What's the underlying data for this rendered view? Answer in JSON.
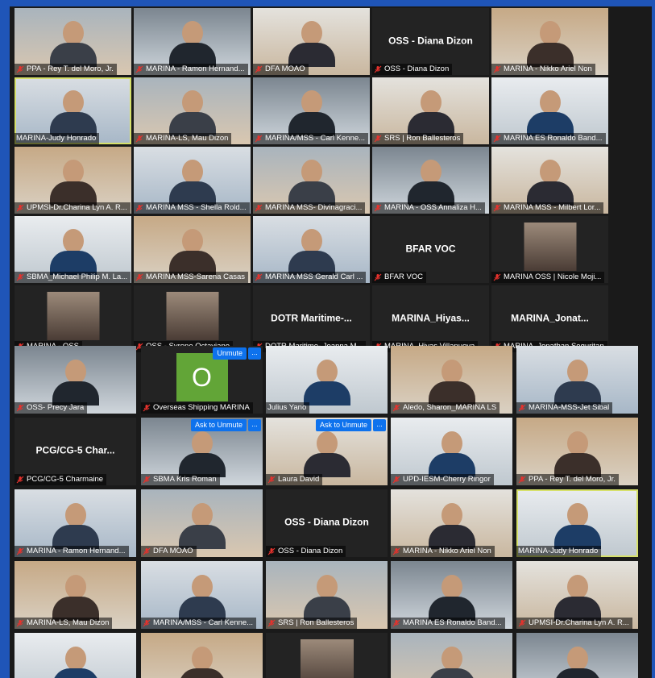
{
  "meeting": {
    "colors": {
      "background": "#1f55b8",
      "active_speaker": "#d6e06a",
      "button_blue": "#0e72ed"
    },
    "icons": {
      "muted": "muted-mic-icon",
      "more": "more-options-icon"
    },
    "buttons": {
      "unmute": "Unmute",
      "ask_to_unmute": "Ask to Unmute",
      "more": "..."
    },
    "tiles": [
      {
        "name": "PPA - Rey T. del Moro, Jr.",
        "type": "video",
        "muted": true
      },
      {
        "name": "MARINA - Ramon Hernand...",
        "type": "video",
        "muted": true
      },
      {
        "name": "DFA MOAO",
        "type": "video",
        "muted": true
      },
      {
        "name": "OSS - Diana Dizon",
        "type": "name",
        "display": "OSS - Diana Dizon",
        "muted": true
      },
      {
        "name": "MARINA - Nikko Ariel Non",
        "type": "video",
        "muted": true
      },
      {
        "name": "MARINA-Judy Honrado",
        "type": "video",
        "muted": false,
        "active": true
      },
      {
        "name": "MARINA-LS, Mau Dizon",
        "type": "video",
        "muted": true
      },
      {
        "name": "MARINA/MSS - Carl Kenne...",
        "type": "video",
        "muted": true
      },
      {
        "name": "SRS | Ron Ballesteros",
        "type": "video",
        "muted": true
      },
      {
        "name": "MARINA ES Ronaldo Band...",
        "type": "video",
        "muted": true
      },
      {
        "name": "UPMSI-Dr.Charina Lyn A. R...",
        "type": "video",
        "muted": true
      },
      {
        "name": "MARINA MSS - Shella Rold...",
        "type": "video",
        "muted": true
      },
      {
        "name": "MARINA MSS- Divinagraci...",
        "type": "video",
        "muted": true
      },
      {
        "name": "MARINA - OSS Annaliza H...",
        "type": "video",
        "muted": true
      },
      {
        "name": "MARINA MSS - Milbert Lor...",
        "type": "video",
        "muted": true
      },
      {
        "name": "SBMA_Michael Philip M. La...",
        "type": "video",
        "muted": true
      },
      {
        "name": "MARINA MSS-Sarena Casas",
        "type": "video",
        "muted": true
      },
      {
        "name": "MARINA MSS Gerald Carl ...",
        "type": "video",
        "muted": true
      },
      {
        "name": "BFAR VOC",
        "type": "name",
        "display": "BFAR VOC",
        "muted": true
      },
      {
        "name": "MARINA OSS | Nicole Moji...",
        "type": "photo",
        "muted": true
      },
      {
        "name": "MARINA - OSS",
        "type": "photo",
        "muted": true
      },
      {
        "name": "OSS - Syrene Octaviano",
        "type": "photo",
        "muted": true
      },
      {
        "name": "DOTR Maritime- Joanna M...",
        "type": "name",
        "display": "DOTR Maritime-...",
        "muted": true
      },
      {
        "name": "MARINA_Hiyas Villanueva",
        "type": "name",
        "display": "MARINA_Hiyas...",
        "muted": true
      },
      {
        "name": "MARINA_Jonathan Seguritan",
        "type": "name",
        "display": "MARINA_Jonat...",
        "muted": true
      },
      {
        "name": "OSS- Precy Jara",
        "type": "video",
        "muted": true
      },
      {
        "name": "Overseas Shipping MARINA",
        "type": "avatar",
        "letter": "O",
        "muted": true,
        "button": "unmute"
      },
      {
        "name": "Julius Yano",
        "type": "video",
        "muted": false
      },
      {
        "name": "Aledo, Sharon_MARINA LS",
        "type": "video",
        "muted": true
      },
      {
        "name": "MARINA-MSS-Jet Sibal",
        "type": "video",
        "muted": true
      },
      {
        "name": "PCG/CG-5 Charmaine",
        "type": "name",
        "display": "PCG/CG-5 Char...",
        "muted": true
      },
      {
        "name": "SBMA Kris Roman",
        "type": "video",
        "muted": true,
        "button": "ask"
      },
      {
        "name": "Laura David",
        "type": "video",
        "muted": true,
        "button": "ask"
      },
      {
        "name": "UPD-IESM-Cherry Ringor",
        "type": "video",
        "muted": true
      },
      {
        "name": "PPA - Rey T. del Moro, Jr.",
        "type": "video",
        "muted": true
      },
      {
        "name": "MARINA - Ramon Hernand...",
        "type": "video",
        "muted": true
      },
      {
        "name": "DFA MOAO",
        "type": "video",
        "muted": true
      },
      {
        "name": "OSS - Diana Dizon",
        "type": "name",
        "display": "OSS - Diana Dizon",
        "muted": true
      },
      {
        "name": "MARINA - Nikko Ariel Non",
        "type": "video",
        "muted": true
      },
      {
        "name": "MARINA-Judy Honrado",
        "type": "video",
        "muted": false,
        "active": true
      },
      {
        "name": "MARINA-LS, Mau Dizon",
        "type": "video",
        "muted": true
      },
      {
        "name": "MARINA/MSS - Carl Kenne...",
        "type": "video",
        "muted": true
      },
      {
        "name": "SRS | Ron Ballesteros",
        "type": "video",
        "muted": true
      },
      {
        "name": "MARINA ES Ronaldo Band...",
        "type": "video",
        "muted": true
      },
      {
        "name": "UPMSI-Dr.Charina Lyn A. R...",
        "type": "video",
        "muted": true
      },
      {
        "name": "",
        "type": "video",
        "muted": false
      },
      {
        "name": "",
        "type": "video",
        "muted": false
      },
      {
        "name": "",
        "type": "photo",
        "muted": false
      },
      {
        "name": "",
        "type": "video",
        "muted": false
      },
      {
        "name": "",
        "type": "video",
        "muted": false
      }
    ]
  }
}
